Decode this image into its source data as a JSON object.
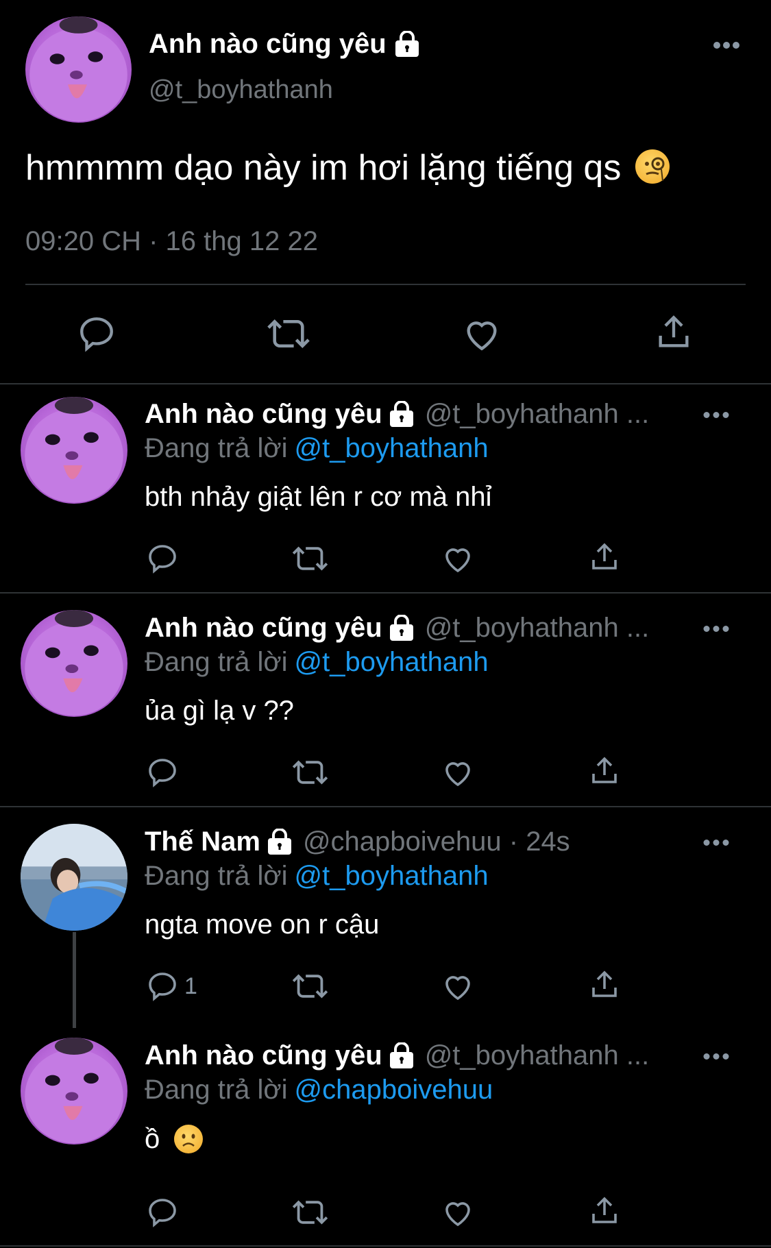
{
  "main_tweet": {
    "name": "Anh nào cũng yêu",
    "handle": "@t_boyhathanh",
    "text": "hmmmm dạo này im hơi lặng tiếng qs",
    "emoji": "face-with-monocle",
    "timestamp": "09:20 CH · 16 thg 12 22"
  },
  "replies": [
    {
      "name": "Anh nào cũng yêu",
      "handle": "@t_boyhathanh ...",
      "replying_label": "Đang trả lời",
      "replying_to": "@t_boyhathanh",
      "text": "bth nhảy giật lên r cơ mà nhỉ",
      "reply_count": ""
    },
    {
      "name": "Anh nào cũng yêu",
      "handle": "@t_boyhathanh ...",
      "replying_label": "Đang trả lời",
      "replying_to": "@t_boyhathanh",
      "text": "ủa gì lạ v ??",
      "reply_count": ""
    },
    {
      "name": "Thế Nam",
      "handle": "@chapboivehuu · 24s",
      "replying_label": "Đang trả lời",
      "replying_to": "@t_boyhathanh",
      "text": "ngta move on r cậu",
      "reply_count": "1"
    },
    {
      "name": "Anh nào cũng yêu",
      "handle": "@t_boyhathanh ...",
      "replying_label": "Đang trả lời",
      "replying_to": "@chapboivehuu",
      "text": "ồ",
      "emoji": "frowning-face",
      "reply_count": ""
    }
  ],
  "colors": {
    "background": "#000000",
    "text": "#e7e9ea",
    "secondary": "#71767b",
    "link": "#1d9bf0",
    "divider": "#2f3336"
  }
}
